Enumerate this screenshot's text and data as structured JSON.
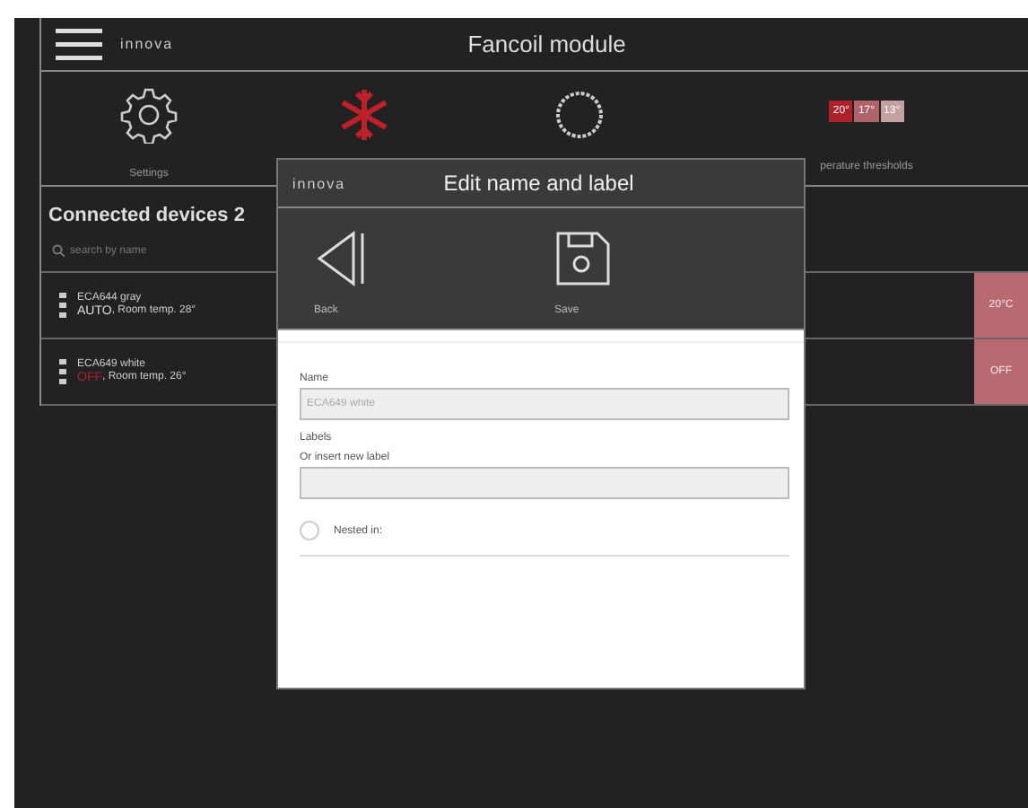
{
  "header": {
    "logo": "innova",
    "title": "Fancoil module"
  },
  "toolbar": [
    {
      "kind": "gear",
      "label": "Settings"
    },
    {
      "kind": "snowflake"
    },
    {
      "kind": "ring"
    },
    {
      "kind": "chips",
      "chips": [
        "20°",
        "17°",
        "13°"
      ],
      "label": "perature thresholds"
    }
  ],
  "devices": {
    "heading": "Connected devices 2",
    "search": {
      "placeholder": "search by name"
    },
    "rows": [
      {
        "name": "ECA644 gray",
        "mode": "AUTO",
        "off": false,
        "temp": ", Room temp. 28°",
        "button": "20°C"
      },
      {
        "name": "ECA649 white",
        "mode": "OFF",
        "off": true,
        "temp": ", Room temp. 26°",
        "button": "OFF"
      }
    ]
  },
  "dialog": {
    "logo": "innova",
    "title": "Edit name and label",
    "actions": [
      {
        "kind": "back",
        "label": "Back"
      },
      {
        "kind": "save",
        "label": "Save"
      }
    ],
    "name_label": "Name",
    "name_value": "ECA649 white",
    "labels_label": "Labels",
    "new_label": "Or insert new label",
    "nested": {
      "label": "Nested in:",
      "checked": false
    }
  }
}
